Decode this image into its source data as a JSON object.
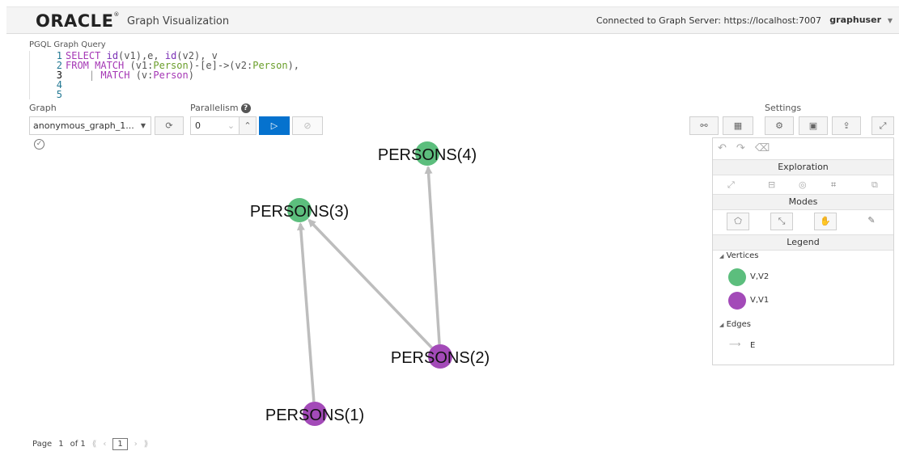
{
  "header": {
    "logo": "ORACLE",
    "logo_mark": "®",
    "app_title": "Graph Visualization",
    "connection": "Connected to Graph Server: https://localhost:7007",
    "user": "graphuser"
  },
  "query": {
    "label": "PGQL Graph Query",
    "lines": [
      {
        "num": "1",
        "text": "SELECT id(v1),e, id(v2), v"
      },
      {
        "num": "2",
        "text": "FROM MATCH (v1:Person)-[e]->(v2:Person),"
      },
      {
        "num": "3",
        "text": "| MATCH (v:Person)"
      },
      {
        "num": "4",
        "text": ""
      },
      {
        "num": "5",
        "text": ""
      }
    ]
  },
  "toolbar": {
    "graph_label": "Graph",
    "graph_value": "anonymous_graph_1...",
    "parallelism_label": "Parallelism",
    "parallelism_value": "0",
    "settings_label": "Settings"
  },
  "graph": {
    "nodes": [
      {
        "id": "n4",
        "label": "PERSONS(4)",
        "color": "#5cbe7d"
      },
      {
        "id": "n3",
        "label": "PERSONS(3)",
        "color": "#5cbe7d"
      },
      {
        "id": "n2",
        "label": "PERSONS(2)",
        "color": "#a34ab8"
      },
      {
        "id": "n1",
        "label": "PERSONS(1)",
        "color": "#a34ab8"
      }
    ],
    "edges": [
      {
        "from": "n1",
        "to": "n3"
      },
      {
        "from": "n2",
        "to": "n3"
      },
      {
        "from": "n2",
        "to": "n4"
      }
    ],
    "edge_color": "#bdbdbd"
  },
  "panel": {
    "exploration_label": "Exploration",
    "modes_label": "Modes",
    "legend_label": "Legend",
    "vertices_label": "Vertices",
    "edges_label": "Edges",
    "legend_vertices": [
      {
        "label": "V,V2",
        "color": "#5cbe7d"
      },
      {
        "label": "V,V1",
        "color": "#a34ab8"
      }
    ],
    "legend_edge": "E"
  },
  "pager": {
    "page_label": "Page",
    "page_current": "1",
    "page_of": "of 1",
    "page_box": "1"
  }
}
